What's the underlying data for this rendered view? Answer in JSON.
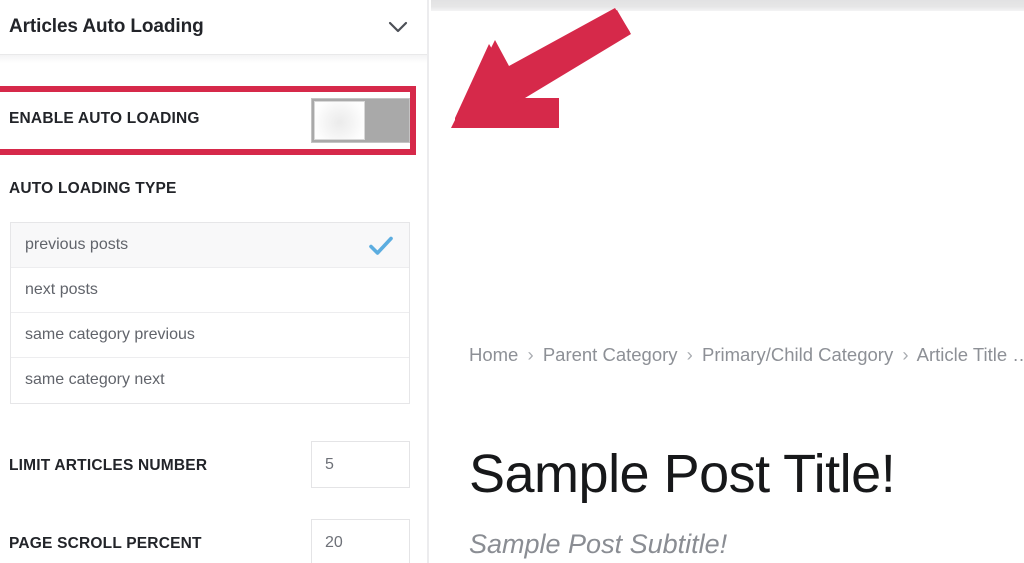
{
  "panel": {
    "header": {
      "title": "Articles Auto Loading",
      "collapse_icon": "chevron-down-icon"
    },
    "enable_auto_loading": {
      "label": "ENABLE AUTO LOADING",
      "toggle_state": "off",
      "highlight_color": "#d6294a"
    },
    "auto_loading_type": {
      "label": "AUTO LOADING TYPE",
      "selected": "previous posts",
      "check_color": "#5cade0",
      "options": [
        {
          "label": "previous posts",
          "selected": true
        },
        {
          "label": "next posts",
          "selected": false
        },
        {
          "label": "same category previous",
          "selected": false
        },
        {
          "label": "same category next",
          "selected": false
        }
      ]
    },
    "limit_articles_number": {
      "label": "LIMIT ARTICLES NUMBER",
      "value": "5",
      "placeholder": "5"
    },
    "page_scroll_percent": {
      "label": "PAGE SCROLL PERCENT",
      "value": "20",
      "placeholder": "20"
    }
  },
  "preview": {
    "annotation_arrow": {
      "icon": "arrow-down-left-icon",
      "color": "#d6294a"
    },
    "breadcrumb": {
      "separator": "›",
      "items": [
        "Home",
        "Parent Category",
        "Primary/Child Category",
        "Article Title …"
      ]
    },
    "post_title": "Sample Post Title!",
    "post_subtitle": "Sample Post Subtitle!"
  }
}
